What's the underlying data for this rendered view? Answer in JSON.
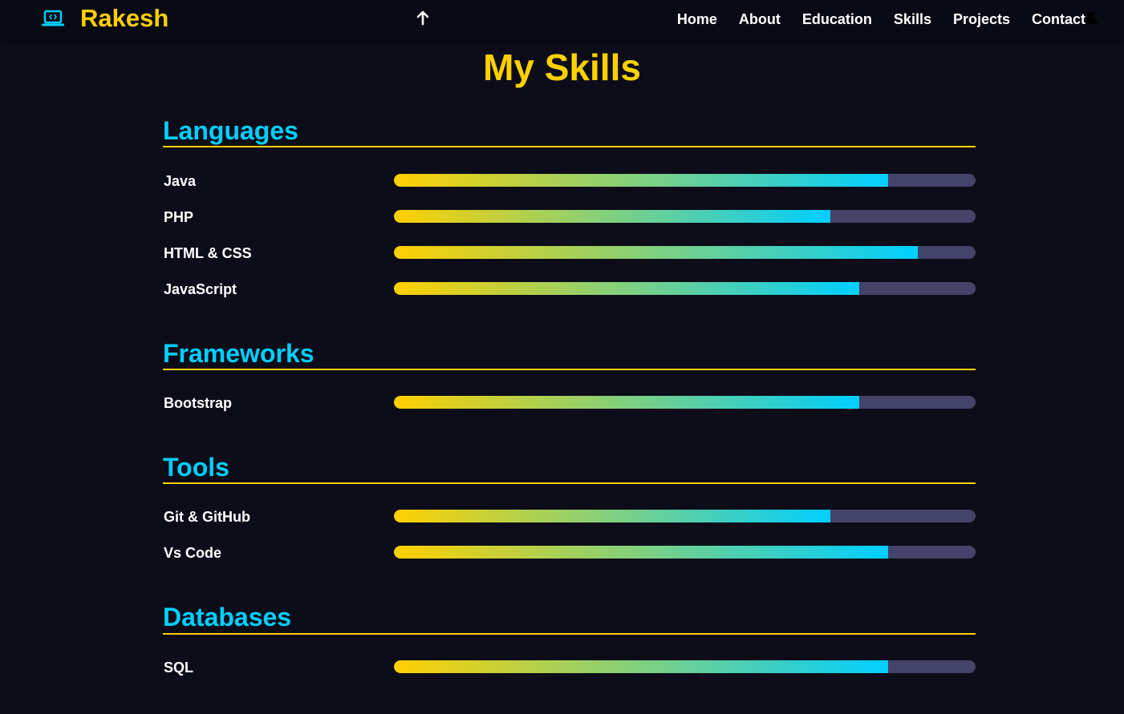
{
  "nav": {
    "brand_name": "Rakesh",
    "brand_icon": "laptop-code-icon",
    "scroll_top_icon": "arrow-up-icon",
    "theme_icon": "moon-icon",
    "links": [
      {
        "label": "Home"
      },
      {
        "label": "About"
      },
      {
        "label": "Education"
      },
      {
        "label": "Skills"
      },
      {
        "label": "Projects"
      },
      {
        "label": "Contact"
      }
    ]
  },
  "page": {
    "title": "My Skills"
  },
  "sections": [
    {
      "name": "Languages",
      "skills": [
        {
          "name": "Java",
          "level": 0.85
        },
        {
          "name": "PHP",
          "level": 0.75
        },
        {
          "name": "HTML & CSS",
          "level": 0.9
        },
        {
          "name": "JavaScript",
          "level": 0.8
        }
      ]
    },
    {
      "name": "Frameworks",
      "skills": [
        {
          "name": "Bootstrap",
          "level": 0.8
        }
      ]
    },
    {
      "name": "Tools",
      "skills": [
        {
          "name": "Git & GitHub",
          "level": 0.75
        },
        {
          "name": "Vs Code",
          "level": 0.85
        }
      ]
    },
    {
      "name": "Databases",
      "skills": [
        {
          "name": "SQL",
          "level": 0.85
        }
      ]
    }
  ],
  "colors": {
    "background": "#0d0d1a",
    "navbar": "#0a0a14",
    "accent_yellow": "#ffd000",
    "accent_cyan": "#00cfff",
    "track": "#44436a",
    "text": "#ffffff"
  }
}
